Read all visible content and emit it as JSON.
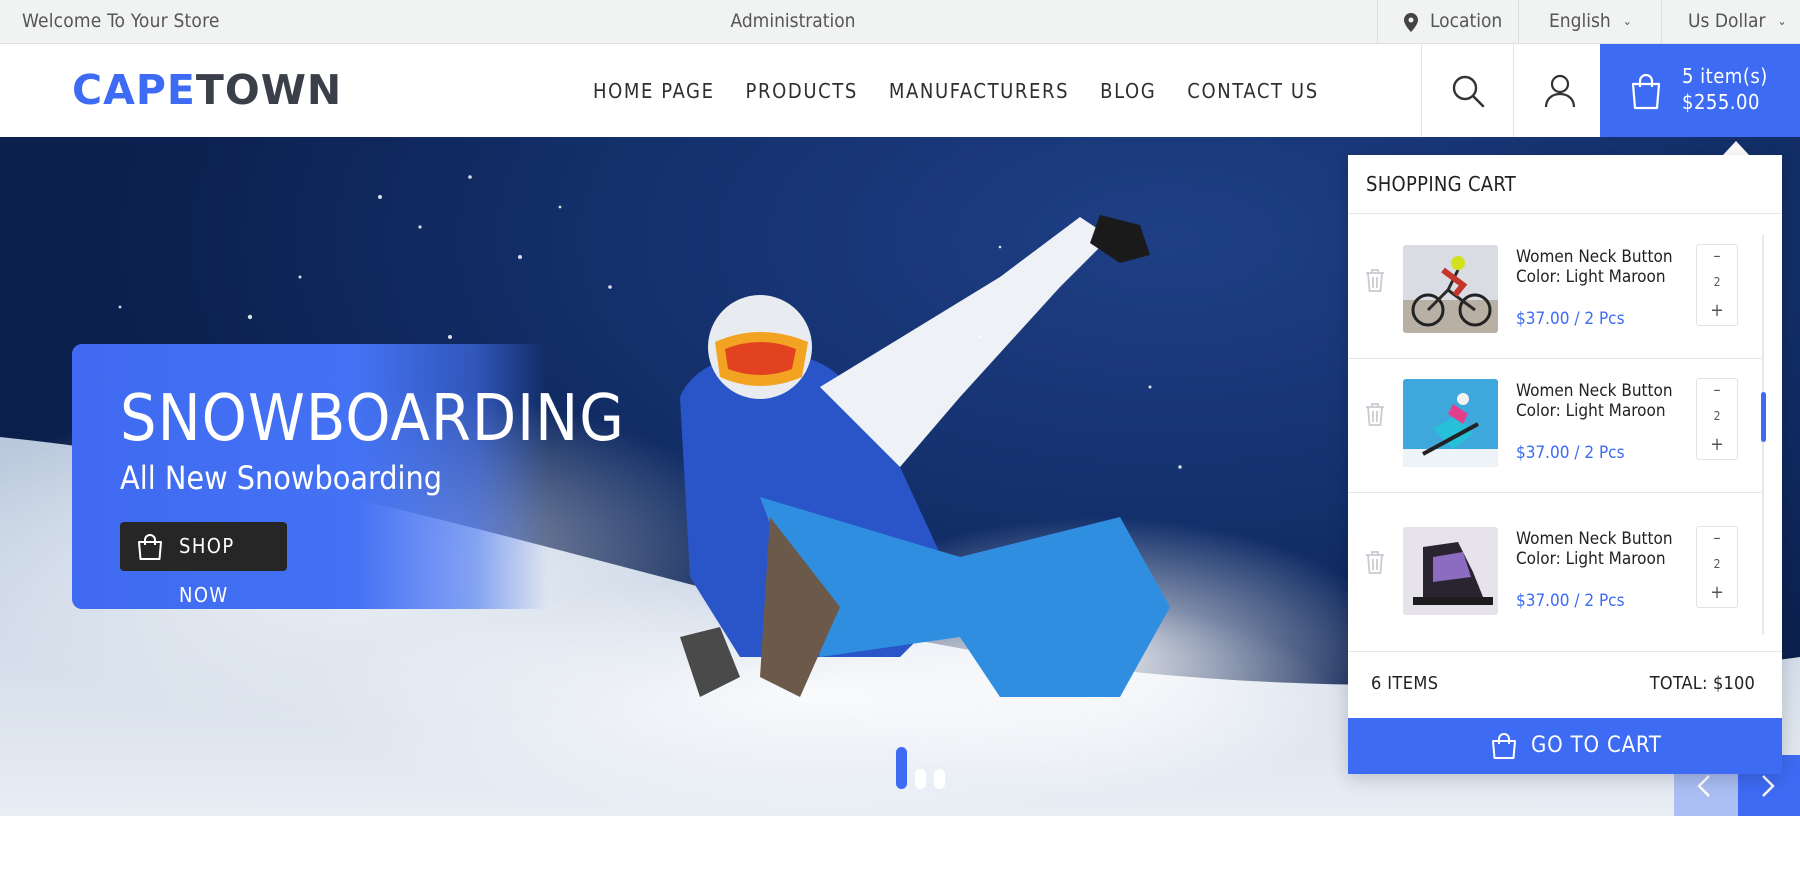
{
  "topbar": {
    "welcome": "Welcome To Your Store",
    "admin": "Administration",
    "location": "Location",
    "language": "English",
    "currency": "Us Dollar"
  },
  "header": {
    "logo_part1": "CAPE",
    "logo_part2": "TOWN",
    "nav": [
      "HOME PAGE",
      "PRODUCTS",
      "MANUFACTURERS",
      "BLOG",
      "CONTACT US"
    ],
    "cart_count": "5 item(s)",
    "cart_total": "$255.00"
  },
  "hero": {
    "title": "SNOWBOARDING",
    "subtitle": "All New Snowboarding",
    "button": "SHOP NOW",
    "active_slide": 1,
    "slide_count": 3
  },
  "minicart": {
    "title": "SHOPPING CART",
    "items": [
      {
        "name": "Women Neck Button",
        "color": "Color: Light Maroon",
        "price": "$37.00 / 2 Pcs",
        "qty": "2",
        "thumb": "cyclist-photo"
      },
      {
        "name": "Women Neck Button",
        "color": "Color: Light Maroon",
        "price": "$37.00 / 2 Pcs",
        "qty": "2",
        "thumb": "snowboarder-jump-photo"
      },
      {
        "name": "Women Neck Button",
        "color": "Color: Light Maroon",
        "price": "$37.00 / 2 Pcs",
        "qty": "2",
        "thumb": "snowboard-binding-photo"
      }
    ],
    "items_count": "6 ITEMS",
    "total": "TOTAL: $100",
    "go_to_cart": "GO TO CART"
  },
  "colors": {
    "accent": "#3d6bf4",
    "dark_button": "#262626",
    "topbar_bg": "#f1f3f3"
  }
}
